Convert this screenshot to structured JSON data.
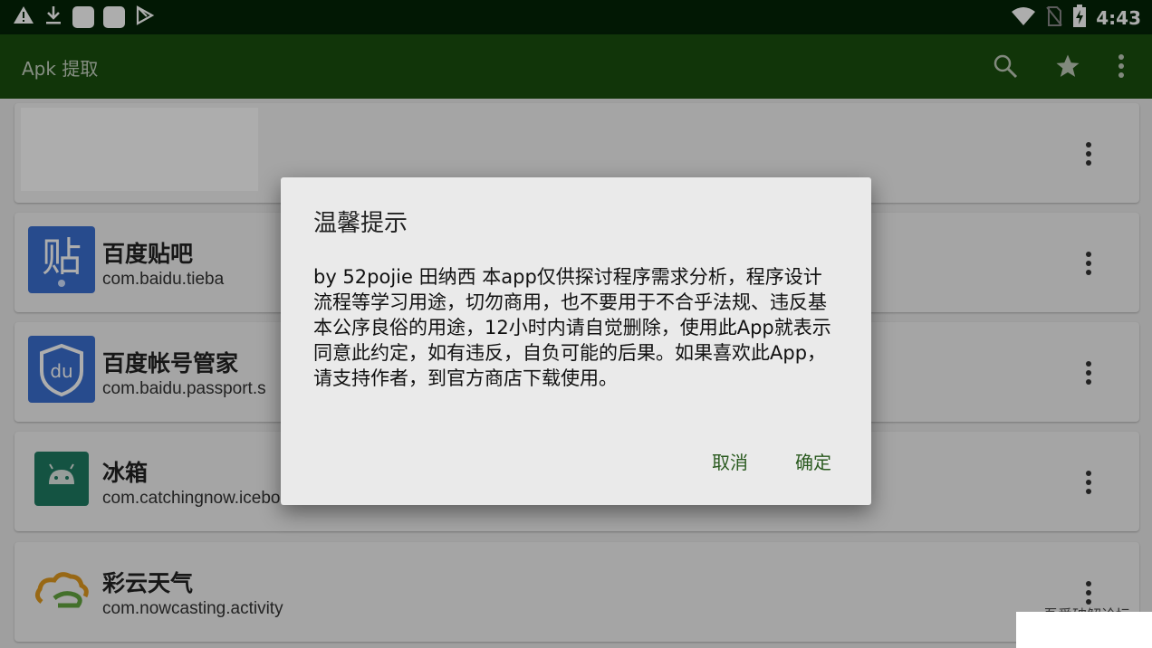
{
  "status_bar": {
    "time": "4:43"
  },
  "app_bar": {
    "title": "Apk 提取",
    "actions": [
      "search-icon",
      "star-icon",
      "more-vert-icon"
    ]
  },
  "apps": [
    {
      "name": "",
      "package": ""
    },
    {
      "name": "百度贴吧",
      "package": "com.baidu.tieba",
      "icon": "tieba-icon",
      "icon_text": "贴"
    },
    {
      "name": "百度帐号管家",
      "package": "com.baidu.passport.s",
      "icon": "passport-icon",
      "icon_text": "du"
    },
    {
      "name": "冰箱",
      "package": "com.catchingnow.icebox",
      "icon": "android-icon"
    },
    {
      "name": "彩云天气",
      "package": "com.nowcasting.activity",
      "icon": "cloud-icon"
    }
  ],
  "dialog": {
    "title": "温馨提示",
    "message": "by  52pojie 田纳西 本app仅供探讨程序需求分析，程序设计流程等学习用途，切勿商用，也不要用于不合乎法规、违反基本公序良俗的用途，12小时内请自觉删除，使用此App就表示同意此约定，如有违反，自负可能的后果。如果喜欢此App，请支持作者，到官方商店下载使用。",
    "cancel_label": "取消",
    "confirm_label": "确定"
  },
  "watermark": "吾爱破解论坛",
  "colors": {
    "status_bar": "#042407",
    "app_bar": "#1a4e0e",
    "dialog_button": "#2a5a1f"
  }
}
